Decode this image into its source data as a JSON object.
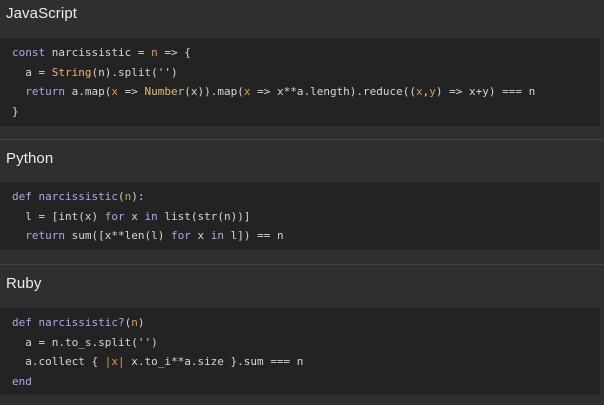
{
  "sections": [
    {
      "title": "JavaScript",
      "lines": [
        [
          {
            "t": "const ",
            "c": "kw"
          },
          {
            "t": "narcissistic = ",
            "c": "pl"
          },
          {
            "t": "n",
            "c": "arg"
          },
          {
            "t": " => {",
            "c": "pl"
          }
        ],
        [
          {
            "t": "  a = ",
            "c": "pl"
          },
          {
            "t": "String",
            "c": "bi"
          },
          {
            "t": "(n).split('')",
            "c": "pl"
          }
        ],
        [
          {
            "t": "  ",
            "c": "pl"
          },
          {
            "t": "return",
            "c": "kw"
          },
          {
            "t": " a.map(",
            "c": "pl"
          },
          {
            "t": "x",
            "c": "arg"
          },
          {
            "t": " => ",
            "c": "pl"
          },
          {
            "t": "Number",
            "c": "bi"
          },
          {
            "t": "(x)).map(",
            "c": "pl"
          },
          {
            "t": "x",
            "c": "arg"
          },
          {
            "t": " => x**a.length).reduce((",
            "c": "pl"
          },
          {
            "t": "x",
            "c": "arg"
          },
          {
            "t": ",",
            "c": "pl"
          },
          {
            "t": "y",
            "c": "arg"
          },
          {
            "t": ") => x+y) === n",
            "c": "pl"
          }
        ],
        [
          {
            "t": "}",
            "c": "pl"
          }
        ]
      ]
    },
    {
      "title": "Python",
      "lines": [
        [
          {
            "t": "def ",
            "c": "kw"
          },
          {
            "t": "narcissistic",
            "c": "kw"
          },
          {
            "t": "(",
            "c": "pl"
          },
          {
            "t": "n",
            "c": "arg"
          },
          {
            "t": "):",
            "c": "pl"
          }
        ],
        [
          {
            "t": "  l = [int(x) ",
            "c": "pl"
          },
          {
            "t": "for",
            "c": "kw"
          },
          {
            "t": " x ",
            "c": "pl"
          },
          {
            "t": "in",
            "c": "kw"
          },
          {
            "t": " list(str(n))]",
            "c": "pl"
          }
        ],
        [
          {
            "t": "  ",
            "c": "pl"
          },
          {
            "t": "return",
            "c": "kw"
          },
          {
            "t": " sum([x**len(l) ",
            "c": "pl"
          },
          {
            "t": "for",
            "c": "kw"
          },
          {
            "t": " x ",
            "c": "pl"
          },
          {
            "t": "in",
            "c": "kw"
          },
          {
            "t": " l]) == n",
            "c": "pl"
          }
        ]
      ]
    },
    {
      "title": "Ruby",
      "lines": [
        [
          {
            "t": "def ",
            "c": "kw"
          },
          {
            "t": "narcissistic?",
            "c": "kw"
          },
          {
            "t": "(",
            "c": "pl"
          },
          {
            "t": "n",
            "c": "arg"
          },
          {
            "t": ")",
            "c": "pl"
          }
        ],
        [
          {
            "t": "  a = n.to_s.split('')",
            "c": "pl"
          }
        ],
        [
          {
            "t": "  a.collect { ",
            "c": "pl"
          },
          {
            "t": "|x|",
            "c": "arg"
          },
          {
            "t": " x.to_i**a.size }.sum === n",
            "c": "pl"
          }
        ],
        [
          {
            "t": "end",
            "c": "kw"
          }
        ]
      ]
    }
  ]
}
